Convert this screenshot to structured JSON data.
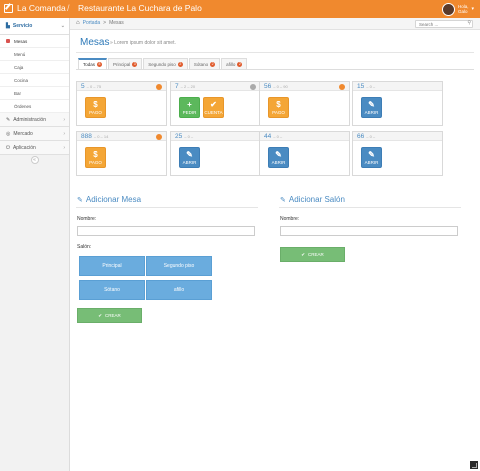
{
  "navbar": {
    "brand": "La Comanda",
    "separator": "/",
    "restaurant": "Restaurante La Cuchara de Palo",
    "user_greeting": "Hola,",
    "user_name": "Galo",
    "accent": "#f0892e"
  },
  "breadcrumb": {
    "home": "Portada",
    "sep": ">",
    "current": "Mesas"
  },
  "search": {
    "placeholder": "Search ..."
  },
  "sidebar": {
    "sections": [
      {
        "label": "Servicio",
        "icon": "dashboard-icon"
      },
      {
        "label": "Administración",
        "icon": "wrench-icon"
      },
      {
        "label": "Mercado",
        "icon": "globe-icon"
      },
      {
        "label": "Aplicación",
        "icon": "power-icon"
      }
    ],
    "servicio_items": [
      "Mesas",
      "Menú",
      "Caja",
      "Cocina",
      "Bar",
      "Órdenes"
    ],
    "collapse_glyph": "«"
  },
  "page": {
    "title": "Mesas",
    "subtitle": "» Lorem ipsum dolor sit amet."
  },
  "tabs": [
    {
      "label": "Todas",
      "count": "8"
    },
    {
      "label": "Principal",
      "count": "3"
    },
    {
      "label": "Segundo piso",
      "count": "2"
    },
    {
      "label": "Sótano",
      "count": "2"
    },
    {
      "label": "afillo",
      "count": "2"
    }
  ],
  "tables": [
    {
      "number": "5",
      "meta": "– 0 – 75",
      "status_color": "#f0892e",
      "actions": [
        {
          "label": "PAGO",
          "style": "orange",
          "icon": "$"
        }
      ]
    },
    {
      "number": "7",
      "meta": "– 2 – 20",
      "status_color": "#aaaaaa",
      "actions": [
        {
          "label": "PEDIR",
          "style": "green",
          "icon": "+"
        },
        {
          "label": "CUENTA",
          "style": "orange",
          "icon": "✔"
        }
      ]
    },
    {
      "number": "56",
      "meta": "– 0 – 90",
      "status_color": "#f0892e",
      "actions": [
        {
          "label": "PAGO",
          "style": "orange",
          "icon": "$"
        }
      ]
    },
    {
      "number": "15",
      "meta": "– 0 –",
      "status_color": "",
      "actions": [
        {
          "label": "ABRIR",
          "style": "blue",
          "icon": "✎"
        }
      ]
    },
    {
      "number": "888",
      "meta": "– 0 – 14",
      "status_color": "#f0892e",
      "actions": [
        {
          "label": "PAGO",
          "style": "orange",
          "icon": "$"
        }
      ]
    },
    {
      "number": "25",
      "meta": "– 0 –",
      "status_color": "",
      "actions": [
        {
          "label": "ABRIR",
          "style": "blue",
          "icon": "✎"
        }
      ]
    },
    {
      "number": "44",
      "meta": "– 0 –",
      "status_color": "",
      "actions": [
        {
          "label": "ABRIR",
          "style": "blue",
          "icon": "✎"
        }
      ]
    },
    {
      "number": "66",
      "meta": "– 0 –",
      "status_color": "",
      "actions": [
        {
          "label": "ABRIR",
          "style": "blue",
          "icon": "✎"
        }
      ]
    }
  ],
  "forms": {
    "mesa": {
      "title": "Adicionar Mesa",
      "name_label": "Nombre:",
      "salon_label": "Salón:",
      "salones": [
        "Principal",
        "Segundo piso",
        "Sótano",
        "afillo"
      ],
      "create_label": "CREAR"
    },
    "salon": {
      "title": "Adicionar Salón",
      "name_label": "Nombre:",
      "create_label": "CREAR"
    }
  }
}
